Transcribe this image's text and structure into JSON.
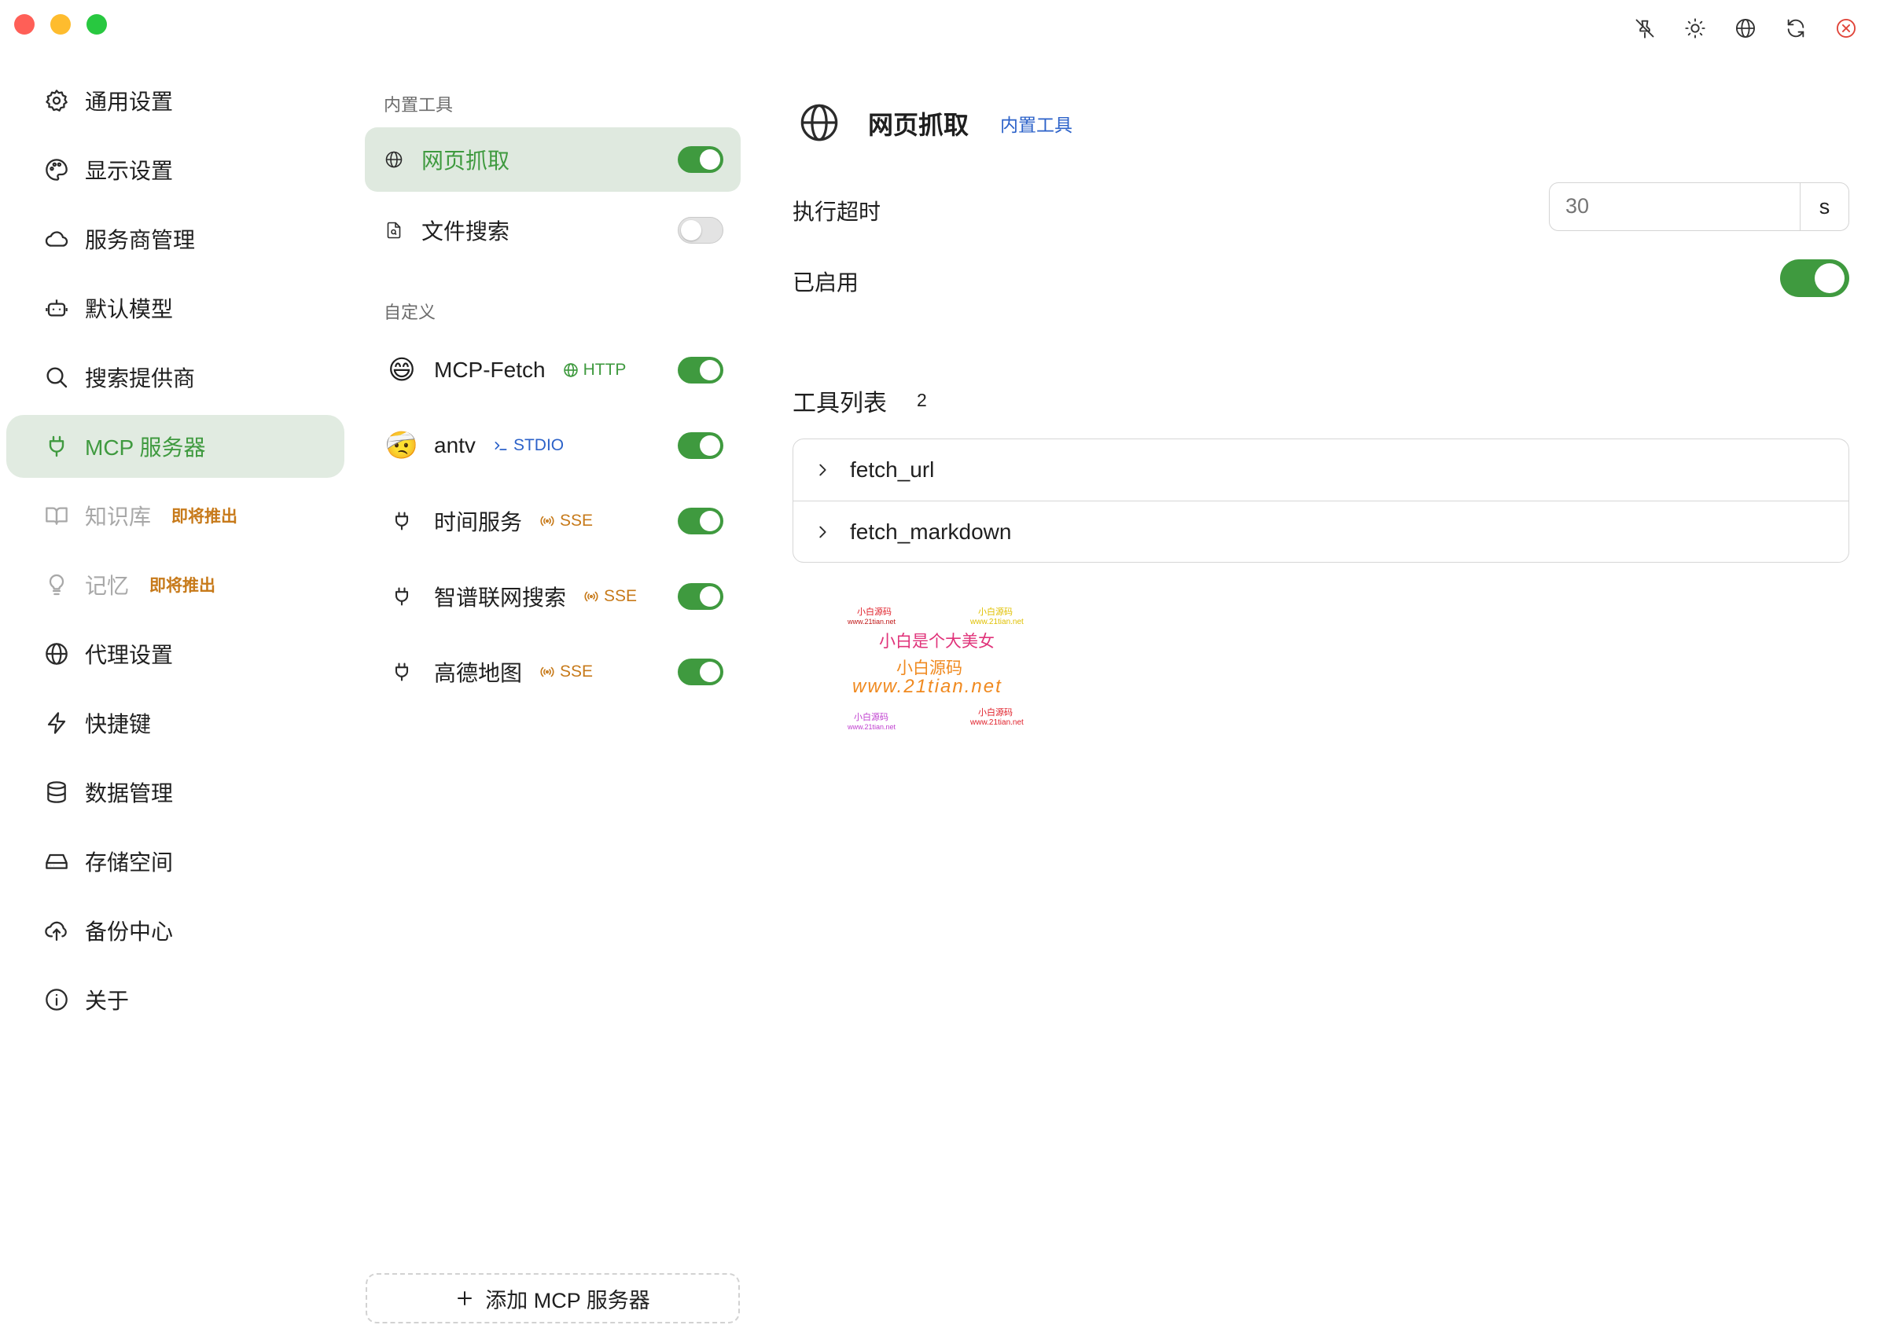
{
  "window": {
    "controls": [
      "close",
      "minimize",
      "zoom"
    ]
  },
  "toolbar": {
    "buttons": [
      {
        "name": "pin-icon"
      },
      {
        "name": "theme-icon"
      },
      {
        "name": "language-icon"
      },
      {
        "name": "refresh-icon"
      },
      {
        "name": "close-icon",
        "color": "#e0453a"
      }
    ]
  },
  "sidebar": {
    "items": [
      {
        "label": "通用设置",
        "icon": "gear-icon"
      },
      {
        "label": "显示设置",
        "icon": "palette-icon"
      },
      {
        "label": "服务商管理",
        "icon": "cloud-icon"
      },
      {
        "label": "默认模型",
        "icon": "robot-icon"
      },
      {
        "label": "搜索提供商",
        "icon": "search-icon"
      },
      {
        "label": "MCP 服务器",
        "icon": "plug-icon",
        "active": true
      },
      {
        "label": "知识库",
        "icon": "book-icon",
        "disabled": true,
        "badge": "即将推出"
      },
      {
        "label": "记忆",
        "icon": "lightbulb-icon",
        "disabled": true,
        "badge": "即将推出"
      },
      {
        "label": "代理设置",
        "icon": "globe-icon"
      },
      {
        "label": "快捷键",
        "icon": "lightning-icon"
      },
      {
        "label": "数据管理",
        "icon": "database-icon"
      },
      {
        "label": "存储空间",
        "icon": "hard-drive-icon"
      },
      {
        "label": "备份中心",
        "icon": "cloud-upload-icon"
      },
      {
        "label": "关于",
        "icon": "info-icon"
      }
    ]
  },
  "builtin": {
    "section_title": "内置工具",
    "items": [
      {
        "label": "网页抓取",
        "icon": "globe-icon",
        "enabled": true,
        "active": true
      },
      {
        "label": "文件搜索",
        "icon": "file-search-icon",
        "enabled": false
      }
    ]
  },
  "custom": {
    "section_title": "自定义",
    "items": [
      {
        "label": "MCP-Fetch",
        "emoji": "😄",
        "tag": "HTTP",
        "tag_type": "http",
        "enabled": true
      },
      {
        "label": "antv",
        "emoji": "🤕",
        "tag": "STDIO",
        "tag_type": "stdio",
        "enabled": true
      },
      {
        "label": "时间服务",
        "icon": "plug-icon",
        "tag": "SSE",
        "tag_type": "sse",
        "enabled": true
      },
      {
        "label": "智谱联网搜索",
        "icon": "plug-icon",
        "tag": "SSE",
        "tag_type": "sse",
        "enabled": true
      },
      {
        "label": "高德地图",
        "icon": "plug-icon",
        "tag": "SSE",
        "tag_type": "sse",
        "enabled": true
      }
    ],
    "add_button": "添加 MCP 服务器"
  },
  "detail": {
    "title": "网页抓取",
    "tag": "内置工具",
    "timeout_label": "执行超时",
    "timeout_placeholder": "30",
    "timeout_unit": "s",
    "enabled_label": "已启用",
    "enabled": true,
    "tools_title": "工具列表",
    "tools_count": "2",
    "tools": [
      "fetch_url",
      "fetch_markdown"
    ]
  },
  "watermark": {
    "lines": [
      "小白源码",
      "www.21tian.net",
      "小白源码",
      "www.21tian.net",
      "小白是个大美女",
      "小白源码",
      "www.21tian.net",
      "小白源码",
      "www.21tian.net",
      "小白源码",
      "www.21tian.net"
    ]
  },
  "colors": {
    "accent": "#3f9a3f",
    "accent_bg": "#e1ebe1",
    "link": "#2c62c9",
    "warning": "#c77a1a"
  }
}
